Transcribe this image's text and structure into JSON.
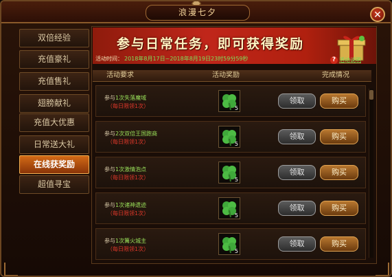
{
  "window": {
    "title": "浪漫七夕",
    "close": "✕"
  },
  "sidebar": {
    "items": [
      {
        "label": "双倍经验"
      },
      {
        "label": "充值豪礼"
      },
      {
        "label": "充值售礼"
      },
      {
        "label": "翅膀献礼"
      },
      {
        "label": "充值大优惠"
      },
      {
        "label": "日常送大礼"
      },
      {
        "label": "在线获奖励"
      },
      {
        "label": "超值寻宝"
      }
    ],
    "active_index": 6
  },
  "banner": {
    "headline": "参与日常任务，即可获得奖励",
    "time_label": "活动时间：",
    "time_value": "2018年8月17日~2018年8月19日23时59分59秒",
    "help_icon": "?",
    "help_link": "活动说明"
  },
  "table": {
    "headers": [
      "活动要求",
      "活动奖励",
      "完成情况"
    ],
    "claim_label": "领取",
    "buy_label": "购买",
    "rows": [
      {
        "prefix": "参与",
        "count": "1次",
        "task": "失落魔域",
        "limit": "（每日限领1次）",
        "reward_count": "5",
        "reward_icon": "clover-icon"
      },
      {
        "prefix": "参与",
        "count": "2次",
        "task": "双倍王国跑商",
        "limit": "（每日限领1次）",
        "reward_count": "5",
        "reward_icon": "clover-icon"
      },
      {
        "prefix": "参与",
        "count": "1次",
        "task": "激情泡点",
        "limit": "（每日限领1次）",
        "reward_count": "5",
        "reward_icon": "clover-icon"
      },
      {
        "prefix": "参与",
        "count": "1次",
        "task": "诸神遗迹",
        "limit": "（每日限领1次）",
        "reward_count": "5",
        "reward_icon": "clover-icon"
      },
      {
        "prefix": "参与",
        "count": "1次",
        "task": "篝火城主",
        "limit": "（每日限领1次）",
        "reward_count": "5",
        "reward_icon": "clover-icon"
      }
    ]
  },
  "colors": {
    "accent": "#d26a16",
    "task_green": "#9ae15a",
    "limit_red": "#e0382a",
    "banner_red": "#c0261a"
  }
}
